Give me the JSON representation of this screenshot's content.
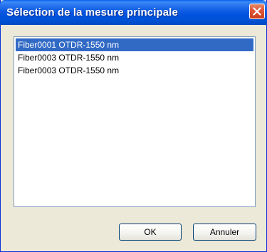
{
  "window": {
    "title": "Sélection de la mesure principale"
  },
  "measurements": {
    "items": [
      {
        "label": "Fiber0001 OTDR-1550 nm",
        "selected": true
      },
      {
        "label": "Fiber0003 OTDR-1550 nm",
        "selected": false
      },
      {
        "label": "Fiber0003 OTDR-1550 nm",
        "selected": false
      }
    ]
  },
  "buttons": {
    "ok_label": "OK",
    "cancel_label": "Annuler"
  },
  "colors": {
    "titlebar": "#0054e3",
    "selection": "#316ac5",
    "close_button": "#e0593a",
    "dialog_bg": "#ece9d8"
  },
  "icons": {
    "close": "close-icon"
  }
}
